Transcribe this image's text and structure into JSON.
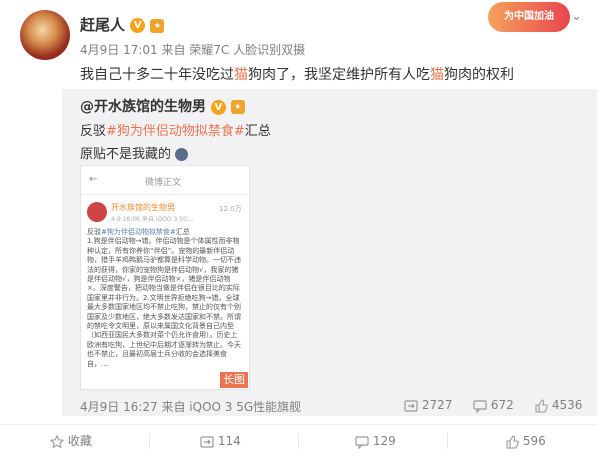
{
  "post": {
    "author": "赶尾人",
    "meta": "4月9日 17:01 来自 荣耀7C 人脸识别双摄",
    "text_before_1": "我自己十多二十年没吃过",
    "highlight": "猫",
    "text_mid": "狗肉了，我坚定维护所有人吃",
    "text_after": "狗肉的权利",
    "campaign_badge": "为中国加油"
  },
  "quote": {
    "author": "@开水族馆的生物男",
    "line1_prefix": "反驳",
    "line1_tag": "#狗为伴侣动物拟禁食#",
    "line1_suffix": "汇总",
    "line2": "原贴不是我藏的",
    "footer": "4月9日 16:27 来自 iQOO 3 5G性能旗舰",
    "reposts": "2727",
    "comments": "672",
    "likes": "4536",
    "long_image_label": "长图",
    "screenshot": {
      "title": "微博正文",
      "author": "开水族馆的生物男",
      "meta": "4-9 16:06 来自 iQOO 3 5G...",
      "follow": "12.0万",
      "tag_line_prefix": "反驳",
      "tag_line_tag": "#狗为伴侣动物拟禁食#",
      "tag_line_suffix": "汇总",
      "body": "1.狗是伴侣动物→错。伴侣动物是个体属性而非物种认定，所有你养你“伴侣”。宠物的最新伴侣动物，猎手羊鸡鸭鹅马驴都算是科学动物。一切不违法的获得，你家的宠物狗是伴侣动物√，我家的猪是伴侣动物√，狗是伴侣动物×，猪是伴侣动物×。深度警告，把动物当做是伴侣在很目比的实际国家里并非行为。2.文明世界拒绝吃狗→错。全球最大多数国家地区均不禁止吃狗，禁止的仅有个别国家及少数地区，绝大多数发达国家和不禁。所谓的禁吃令文明里，原以来属国文化背景自己内型（如西亚国民大多数对菜个仍允许食用）。历史上欧洲有吃狗，上世纪中后期才逐渐转为禁止。今天也不禁止，且最初高层士兵分收的会选择美食自，..."
    }
  },
  "actions": {
    "favorite": "收藏",
    "repost": "114",
    "comment": "129",
    "like": "596"
  }
}
